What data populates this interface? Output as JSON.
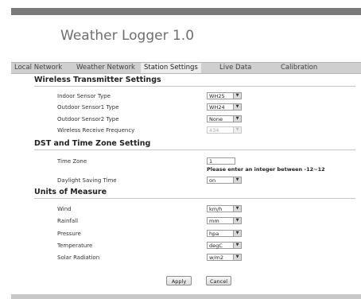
{
  "app": {
    "title": "Weather Logger 1.0"
  },
  "nav": {
    "tabs": [
      {
        "label": "Local Network"
      },
      {
        "label": "Weather Network"
      },
      {
        "label": "Station Settings"
      },
      {
        "label": "Live Data"
      },
      {
        "label": "Calibration"
      }
    ]
  },
  "sections": {
    "wireless": {
      "title": "Wireless Transmitter Settings",
      "fields": [
        {
          "label": "Indoor Sensor Type",
          "value": "WH25"
        },
        {
          "label": "Outdoor Sensor1 Type",
          "value": "WH24"
        },
        {
          "label": "Outdoor Sensor2 Type",
          "value": "None"
        },
        {
          "label": "Wireless Receive Frequency",
          "value": "434"
        }
      ]
    },
    "dst": {
      "title": "DST and Time Zone Setting",
      "timezone": {
        "label": "Time Zone",
        "value": "1",
        "hint": "Please enter an integer between -12~12"
      },
      "daylight": {
        "label": "Daylight Saving Time",
        "value": "on"
      }
    },
    "units": {
      "title": "Units of Measure",
      "fields": [
        {
          "label": "Wind",
          "value": "km/h"
        },
        {
          "label": "Rainfall",
          "value": "mm"
        },
        {
          "label": "Pressure",
          "value": "hpa"
        },
        {
          "label": "Temperature",
          "value": "degC"
        },
        {
          "label": "Solar Radiation",
          "value": "w/m2"
        }
      ]
    }
  },
  "buttons": {
    "apply": "Apply",
    "cancel": "Cancel"
  },
  "icons": {
    "dropdown_arrow": "▼"
  }
}
